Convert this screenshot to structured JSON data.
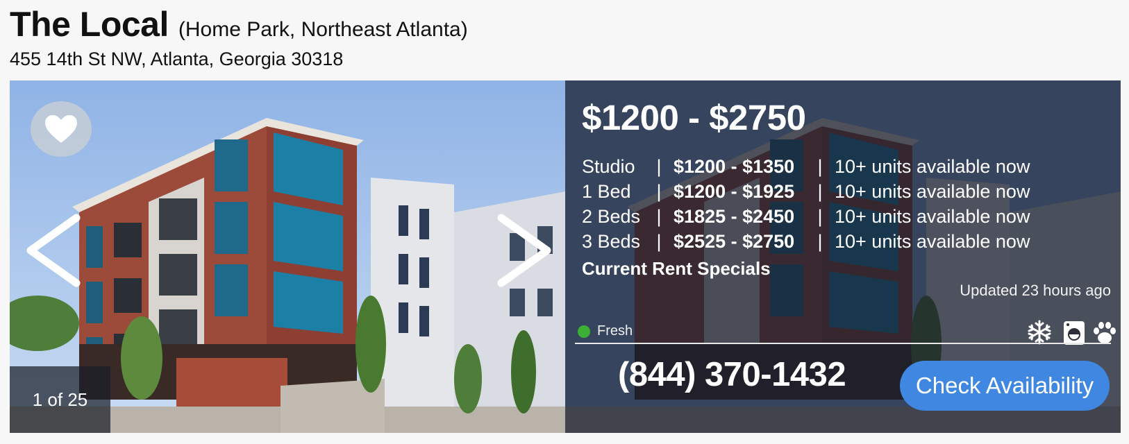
{
  "listing": {
    "name": "The Local",
    "neighborhood": "(Home Park, Northeast Atlanta)",
    "address": "455 14th St NW, Atlanta, Georgia 30318"
  },
  "gallery": {
    "counter": "1 of 25",
    "current_index": 1,
    "total": 25,
    "prev_icon": "chevron-left-icon",
    "next_icon": "chevron-right-icon",
    "favorite_icon": "heart-icon"
  },
  "pricing": {
    "range": "$1200 - $2750",
    "separator": "|",
    "rows": [
      {
        "type": "Studio",
        "price": "$1200 - $1350",
        "availability": "10+ units available now"
      },
      {
        "type": "1 Bed",
        "price": "$1200 - $1925",
        "availability": "10+ units available now"
      },
      {
        "type": "2 Beds",
        "price": "$1825 - $2450",
        "availability": "10+ units available now"
      },
      {
        "type": "3 Beds",
        "price": "$2525 - $2750",
        "availability": "10+ units available now"
      }
    ],
    "specials_label": "Current Rent Specials",
    "updated": "Updated 23 hours ago"
  },
  "status": {
    "fresh_label": "Fresh",
    "fresh_color": "#3cb035"
  },
  "amenities": [
    "snowflake-icon",
    "washer-icon",
    "paw-icon"
  ],
  "contact": {
    "phone": "(844) 370-1432",
    "cta_label": "Check Availability",
    "cta_color": "#3f87e0"
  }
}
